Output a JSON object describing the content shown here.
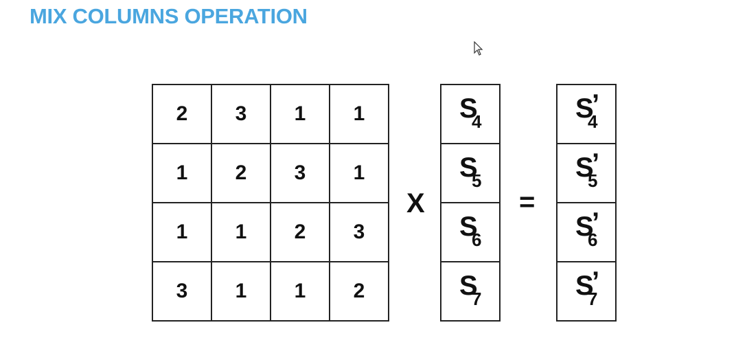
{
  "title": "MIX COLUMNS OPERATION",
  "matrix": [
    [
      "2",
      "3",
      "1",
      "1"
    ],
    [
      "1",
      "2",
      "3",
      "1"
    ],
    [
      "1",
      "1",
      "2",
      "3"
    ],
    [
      "3",
      "1",
      "1",
      "2"
    ]
  ],
  "multiply_symbol": "X",
  "equals_symbol": "=",
  "input_vector": {
    "symbol": "S",
    "subscripts": [
      "4",
      "5",
      "6",
      "7"
    ]
  },
  "output_vector": {
    "symbol": "S",
    "prime": "’",
    "subscripts": [
      "4",
      "5",
      "6",
      "7"
    ]
  },
  "colors": {
    "title": "#4aa6df",
    "border": "#222222",
    "text": "#111111"
  },
  "icons": {
    "cursor": "mouse-pointer-icon"
  }
}
